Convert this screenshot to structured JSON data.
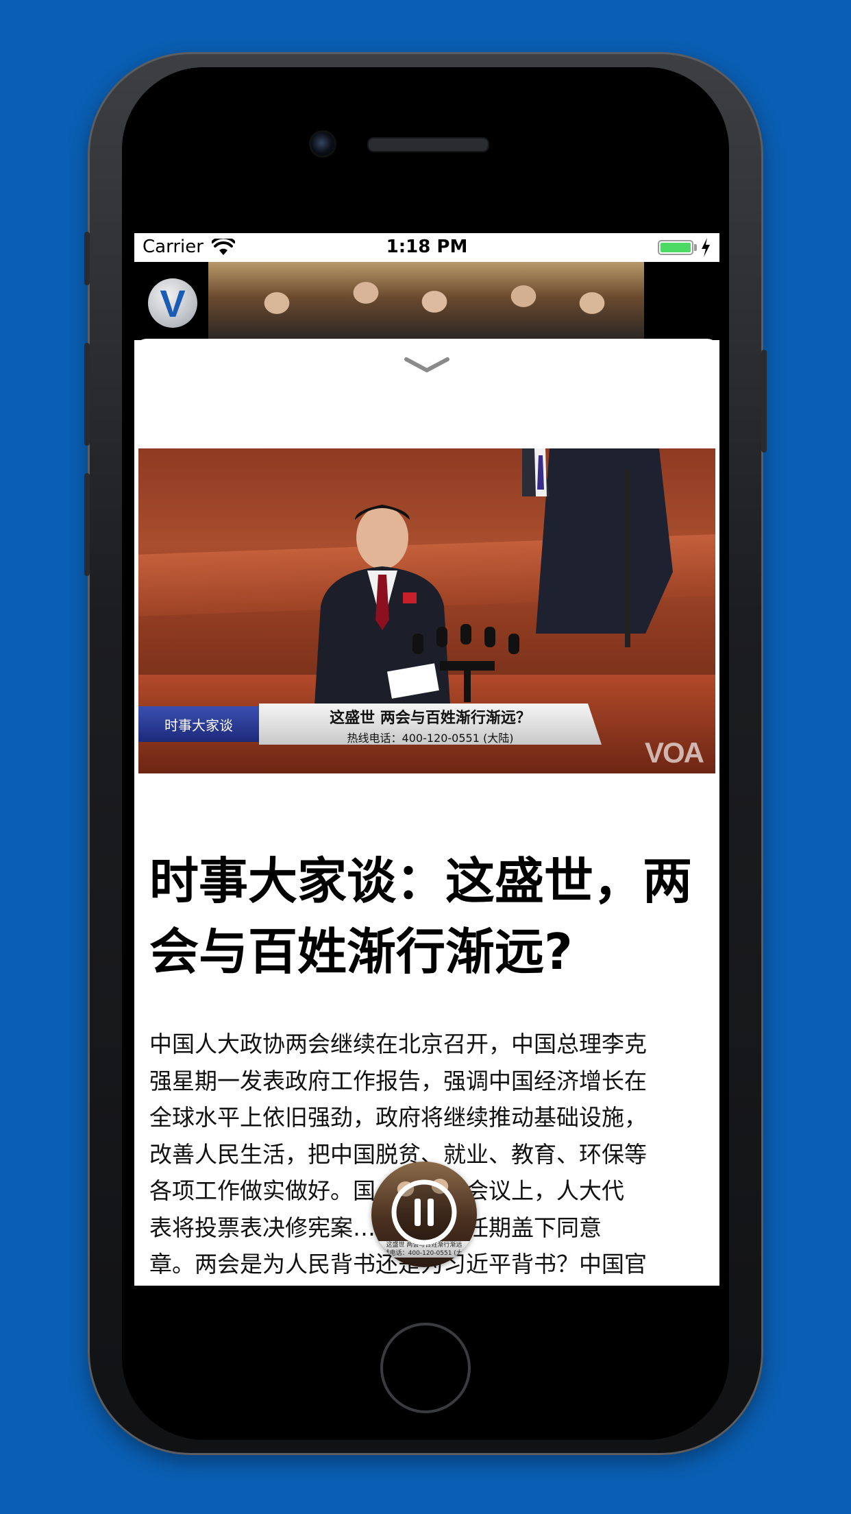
{
  "status_bar": {
    "carrier": "Carrier",
    "time": "1:18 PM"
  },
  "background_video": {
    "logo_letter": "V"
  },
  "player": {
    "show_name": "时事大家谈",
    "headline": "这盛世   两会与百姓渐行渐远？",
    "hotline": "热线电话：400-120-0551 (大陆)",
    "watermark": "VOA"
  },
  "article": {
    "title": "时事大家谈：这盛世，两会与百姓渐行渐远?",
    "body_lines": [
      "中国人大政协两会继续在北京召开，中国总理李克",
      "强星期一发表政府工作报告，强调中国经济增长在",
      "全球水平上依旧强劲，政府将继续推动基础设施，",
      "改善人民生活，把中国脱贫、就业、教育、环保等",
      "各项工作做实做好。国……这场会议上，人大代",
      "表将投票表决修宪案……平延长任期盖下同意",
      "章。两会是为人民背书还是为习近平背书？中国官"
    ]
  },
  "mini_player": {
    "caption_line1": "这盛世  两会与百姓渐行渐远",
    "caption_line2": "热线电话：400-120-0551 (大陆)",
    "state_icon": "pause-icon"
  },
  "colors": {
    "background": "#0a5fb4",
    "battery": "#4cd964",
    "brand_blue": "#1a5bb5"
  }
}
